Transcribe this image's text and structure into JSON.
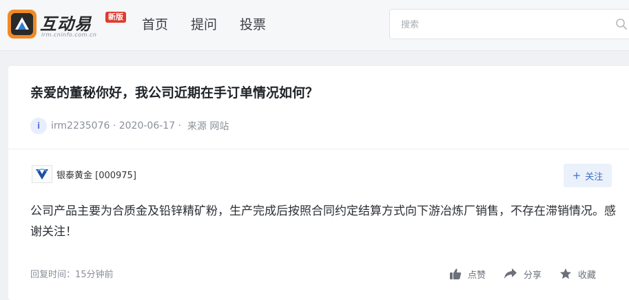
{
  "header": {
    "logo_text": "互动易",
    "logo_badge": "新版",
    "logo_url": "irm.cninfo.com.cn",
    "nav": [
      "首页",
      "提问",
      "投票"
    ],
    "search_placeholder": "搜索"
  },
  "question": {
    "title": "亲爱的董秘你好，我公司近期在手订单情况如何？",
    "avatar_letter": "i",
    "user": "irm2235076",
    "date": " · 2020-06-17 · ",
    "source": " 来源 网站"
  },
  "answer": {
    "company": "银泰黄金 [000975]",
    "follow_label": "关注",
    "text": "公司产品主要为合质金及铅锌精矿粉，生产完成后按照合同约定结算方式向下游冶炼厂销售，不存在滞销情况。感谢关注！",
    "reply_time": "回复时间：15分钟前",
    "actions": {
      "like": "点赞",
      "share": "分享",
      "favorite": "收藏"
    }
  },
  "colors": {
    "accent": "#3d6fc7",
    "badge": "#e03a2f",
    "logo_orange": "#f08a24"
  }
}
